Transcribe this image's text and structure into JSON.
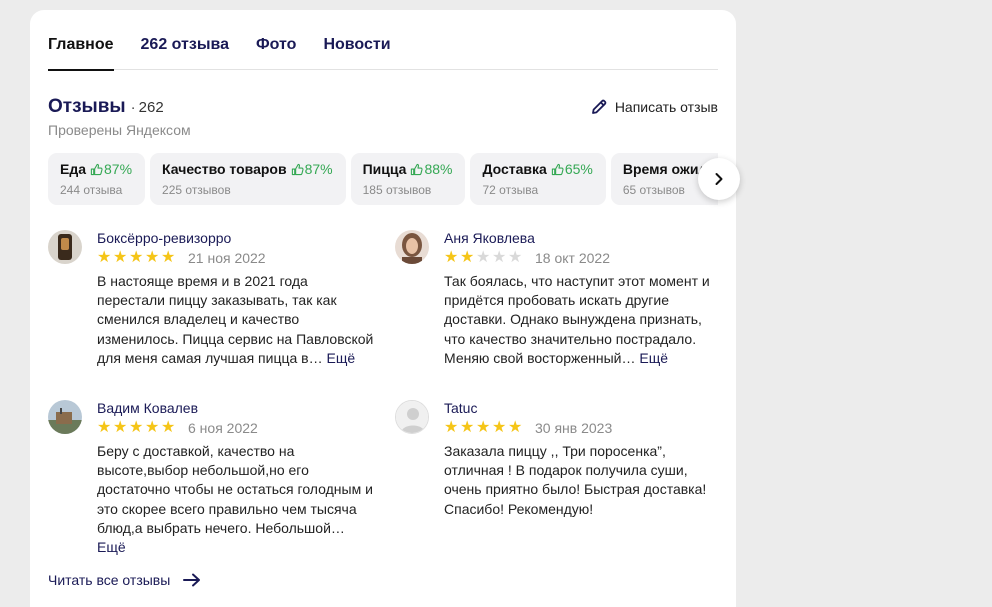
{
  "tabs": [
    {
      "label": "Главное",
      "active": true
    },
    {
      "label": "262 отзыва"
    },
    {
      "label": "Фото"
    },
    {
      "label": "Новости"
    }
  ],
  "reviews_header": {
    "title": "Отзывы",
    "separator": "·",
    "count": "262",
    "verified": "Проверены Яндексом",
    "write_label": "Написать отзыв"
  },
  "aspects": [
    {
      "name": "Еда",
      "percent": "87%",
      "count": "244 отзыва"
    },
    {
      "name": "Качество товаров",
      "percent": "87%",
      "count": "225 отзывов"
    },
    {
      "name": "Пицца",
      "percent": "88%",
      "count": "185 отзывов"
    },
    {
      "name": "Доставка",
      "percent": "65%",
      "count": "72 отзыва"
    },
    {
      "name": "Время ожидания",
      "percent": "",
      "count": "65 отзывов"
    }
  ],
  "reviews": [
    {
      "author": "Боксёрро-ревизорро",
      "rating": 5,
      "date": "21 ноя 2022",
      "text": "В настояще время и в 2021 года перестали пиццу заказывать, так как сменился владелец и качество изменилось. Пицца сервис на Павловской для меня самая лучшая пицца в…",
      "more": "Ещё"
    },
    {
      "author": "Аня Яковлева",
      "rating": 2,
      "date": "18 окт 2022",
      "text": "Так боялась, что наступит этот момент и придётся пробовать искать другие доставки. Однако вынуждена признать, что качество значительно пострадало. Меняю свой восторженный…",
      "more": "Ещё"
    },
    {
      "author": "Вадим Ковалев",
      "rating": 5,
      "date": "6 ноя 2022",
      "text": "Беру с доставкой, качество на высоте,выбор небольшой,но его достаточно чтобы не остаться голодным и это скорее всего правильно чем тысяча блюд,а выбрать нечего. Небольшой…",
      "more": "Ещё"
    },
    {
      "author": "Tatuc",
      "rating": 5,
      "date": "30 янв 2023",
      "text": "Заказала пиццу ,, Три поросенка”, отличная ! В подарок получила суши, очень приятно было! Быстрая доставка! Спасибо! Рекомендую!",
      "more": ""
    }
  ],
  "read_all_label": "Читать все отзывы",
  "colors": {
    "accent": "#1a1a56",
    "star": "#f5c518",
    "positive": "#35a854"
  },
  "icons": [
    "pencil-icon",
    "thumb-up-icon",
    "chevron-right-icon",
    "arrow-right-icon",
    "star-icon"
  ]
}
